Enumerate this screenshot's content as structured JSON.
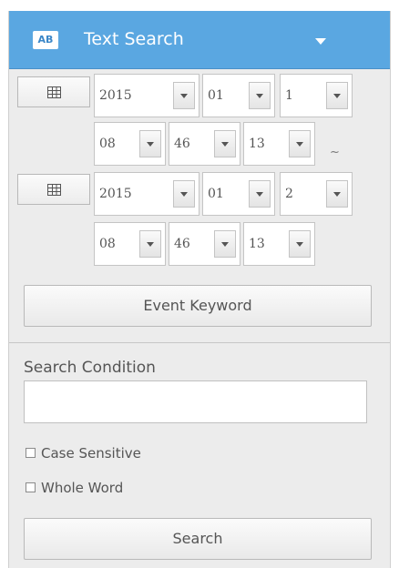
{
  "header": {
    "badge": "AB",
    "title": "Text Search"
  },
  "start": {
    "year": "2015",
    "month": "01",
    "day": "1",
    "hour": "08",
    "minute": "46",
    "second": "13"
  },
  "range_separator": "~",
  "end": {
    "year": "2015",
    "month": "01",
    "day": "2",
    "hour": "08",
    "minute": "46",
    "second": "13"
  },
  "event_keyword_label": "Event Keyword",
  "search_condition": {
    "label": "Search Condition",
    "value": ""
  },
  "options": {
    "case_sensitive": {
      "label": "Case Sensitive",
      "checked": false
    },
    "whole_word": {
      "label": "Whole Word",
      "checked": false
    }
  },
  "search_button_label": "Search",
  "colors": {
    "header_bg": "#5aa7e1",
    "panel_bg": "#ececec"
  }
}
